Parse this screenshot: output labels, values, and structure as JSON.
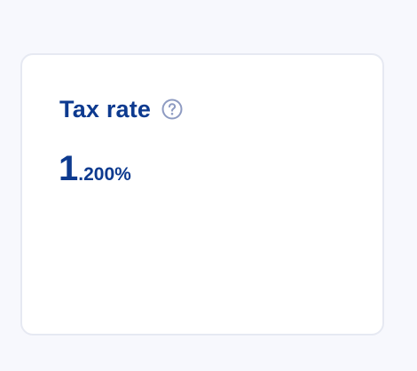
{
  "card": {
    "title": "Tax rate",
    "help_icon": "question-circle-icon",
    "value": {
      "integer": "1",
      "fraction": ".200",
      "unit": "%"
    }
  },
  "colors": {
    "page_background": "#f7f8fd",
    "card_background": "#ffffff",
    "card_border": "#e6e9f2",
    "primary_text": "#0d3a8f",
    "help_icon": "#8e9bc2"
  }
}
